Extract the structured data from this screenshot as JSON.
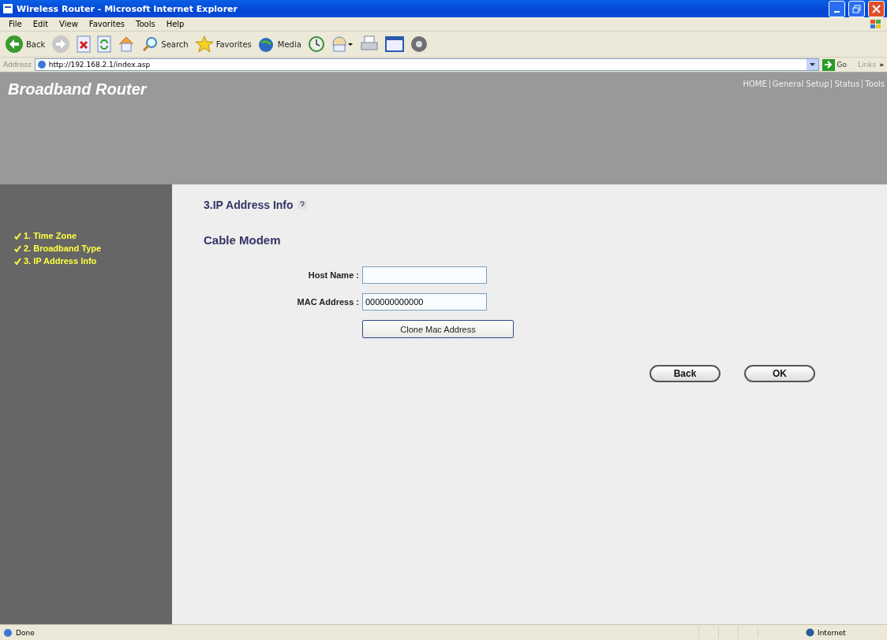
{
  "window": {
    "title": "Wireless Router - Microsoft Internet Explorer"
  },
  "menu": [
    "File",
    "Edit",
    "View",
    "Favorites",
    "Tools",
    "Help"
  ],
  "toolbar": [
    {
      "kind": "back",
      "label": "Back"
    },
    {
      "kind": "forward"
    },
    {
      "kind": "stop"
    },
    {
      "kind": "refresh"
    },
    {
      "kind": "home"
    },
    {
      "kind": "search",
      "label": "Search"
    },
    {
      "kind": "favorites",
      "label": "Favorites"
    },
    {
      "kind": "media",
      "label": "Media"
    },
    {
      "kind": "history"
    },
    {
      "kind": "mail"
    },
    {
      "kind": "print"
    },
    {
      "kind": "edit"
    },
    {
      "kind": "messenger"
    }
  ],
  "address": {
    "label": "Address",
    "value": "http://192.168.2.1/index.asp",
    "go": "Go",
    "links": "Links",
    "more": "»"
  },
  "header": {
    "brand": "Broadband Router",
    "nav": [
      "HOME",
      "General Setup",
      "Status",
      "Tools"
    ]
  },
  "sidebar": {
    "items": [
      {
        "label": "1. Time Zone",
        "checked": true
      },
      {
        "label": "2. Broadband Type",
        "checked": true
      },
      {
        "label": "3. IP Address Info",
        "checked": true
      }
    ]
  },
  "content": {
    "title": "3.IP Address Info",
    "section": "Cable Modem",
    "fields": [
      {
        "label": "Host Name :"
      },
      {
        "label": "MAC Address :",
        "value": "000000000000"
      }
    ],
    "clone_button": "Clone Mac Address",
    "buttons": [
      "Back",
      "OK"
    ]
  },
  "status_bar": {
    "text": "Done",
    "zone": "Internet"
  }
}
